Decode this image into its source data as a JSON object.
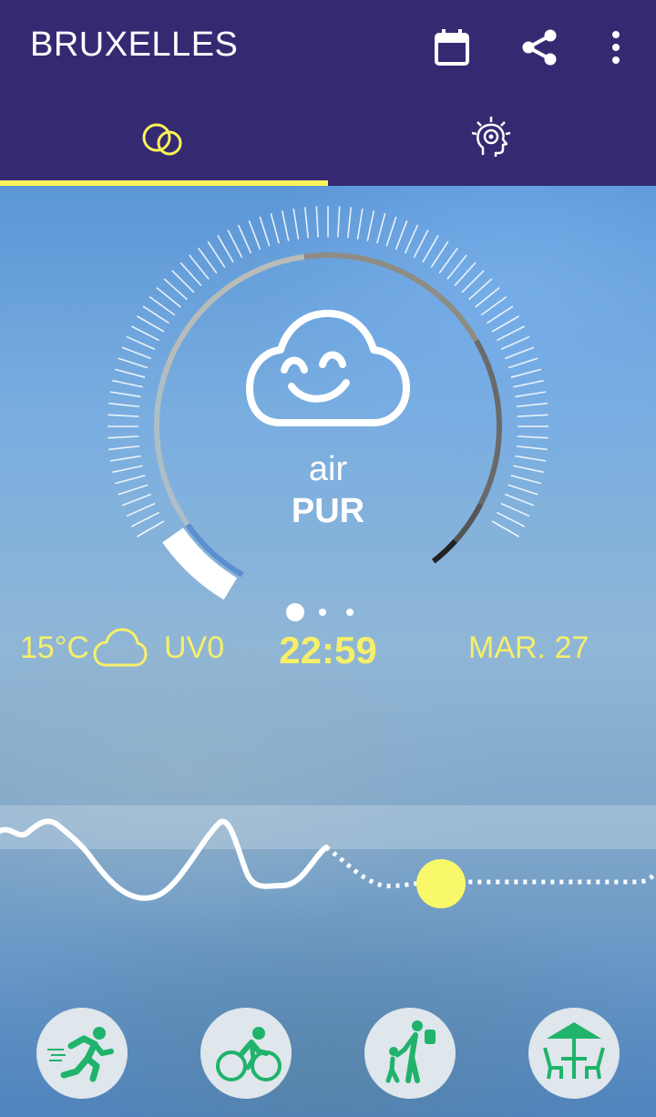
{
  "app_bar": {
    "city": "BRUXELLES",
    "calendar_icon": "calendar-icon",
    "share_icon": "share-icon",
    "menu_icon": "more-vert-icon"
  },
  "tabs": [
    {
      "icon": "air-bubbles-icon",
      "selected": true
    },
    {
      "icon": "head-health-icon",
      "selected": false
    }
  ],
  "air_quality": {
    "face_icon": "smiling-cloud-icon",
    "word": "air",
    "level": "PUR"
  },
  "pager": {
    "count": 3,
    "active_index": 0
  },
  "weather": {
    "temperature": "15°C",
    "condition_icon": "cloud-icon",
    "uv": "UV0",
    "time": "22:59",
    "date": "MAR. 27"
  },
  "timeline": {
    "current_marker_icon": "sun-marker-icon"
  },
  "activities": [
    {
      "icon": "running-icon"
    },
    {
      "icon": "cycling-icon"
    },
    {
      "icon": "family-walking-icon"
    },
    {
      "icon": "terrace-table-icon"
    }
  ],
  "colors": {
    "app_bar": "#352a72",
    "accent_yellow": "#f7ef6a",
    "activity_green": "#1fb36b"
  }
}
